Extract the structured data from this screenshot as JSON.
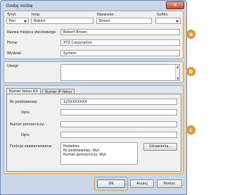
{
  "window": {
    "title": "Dodaj osobę",
    "close_glyph": "×"
  },
  "name_fields": {
    "title_label": "Tytuł:",
    "title_value": "Pan",
    "first_label": "Imię:",
    "first_value": "Robert",
    "last_label": "Nazwisko:",
    "last_value": "Brown",
    "suffix_label": "Sufiks:",
    "suffix_value": ""
  },
  "info_fields": [
    {
      "label": "Nazwa miejsca docelowego:",
      "value": "Robert Brown"
    },
    {
      "label": "Firma:",
      "value": "XYZ Corporation"
    },
    {
      "label": "Wydział:",
      "value": "System"
    }
  ],
  "notes": {
    "label": "Uwagi:",
    "value": "",
    "scroll_up": "▲",
    "scroll_down": "▼"
  },
  "tabs": [
    {
      "label": "Numer faksu G3",
      "active": true
    },
    {
      "label": "Numer IP faksu",
      "active": false
    }
  ],
  "fax": {
    "main_label": "Nr podstawowy:",
    "main_value": "123XXXXXXX",
    "main_ext_label": "Opis:",
    "main_ext_value": "",
    "sub_label": "Numer pomocniczy:",
    "sub_value": "",
    "sub_ext_label": "Opis:",
    "sub_ext_value": "",
    "advanced_label": "Funkcja zaawansowana:",
    "advanced_lines": [
      "Podadres",
      "Nr podstawowy:     Wył.",
      "Numer pomocniczy:  Wył."
    ],
    "settings_button": "Ustawienia..."
  },
  "badges": {
    "a": "a",
    "b": "b",
    "c": "c"
  },
  "footer": {
    "ok": "OK",
    "cancel": "Anuluj",
    "help": "Pomoc"
  },
  "colors": {
    "highlight": "#e59a2b",
    "badge": "#e8962a"
  }
}
